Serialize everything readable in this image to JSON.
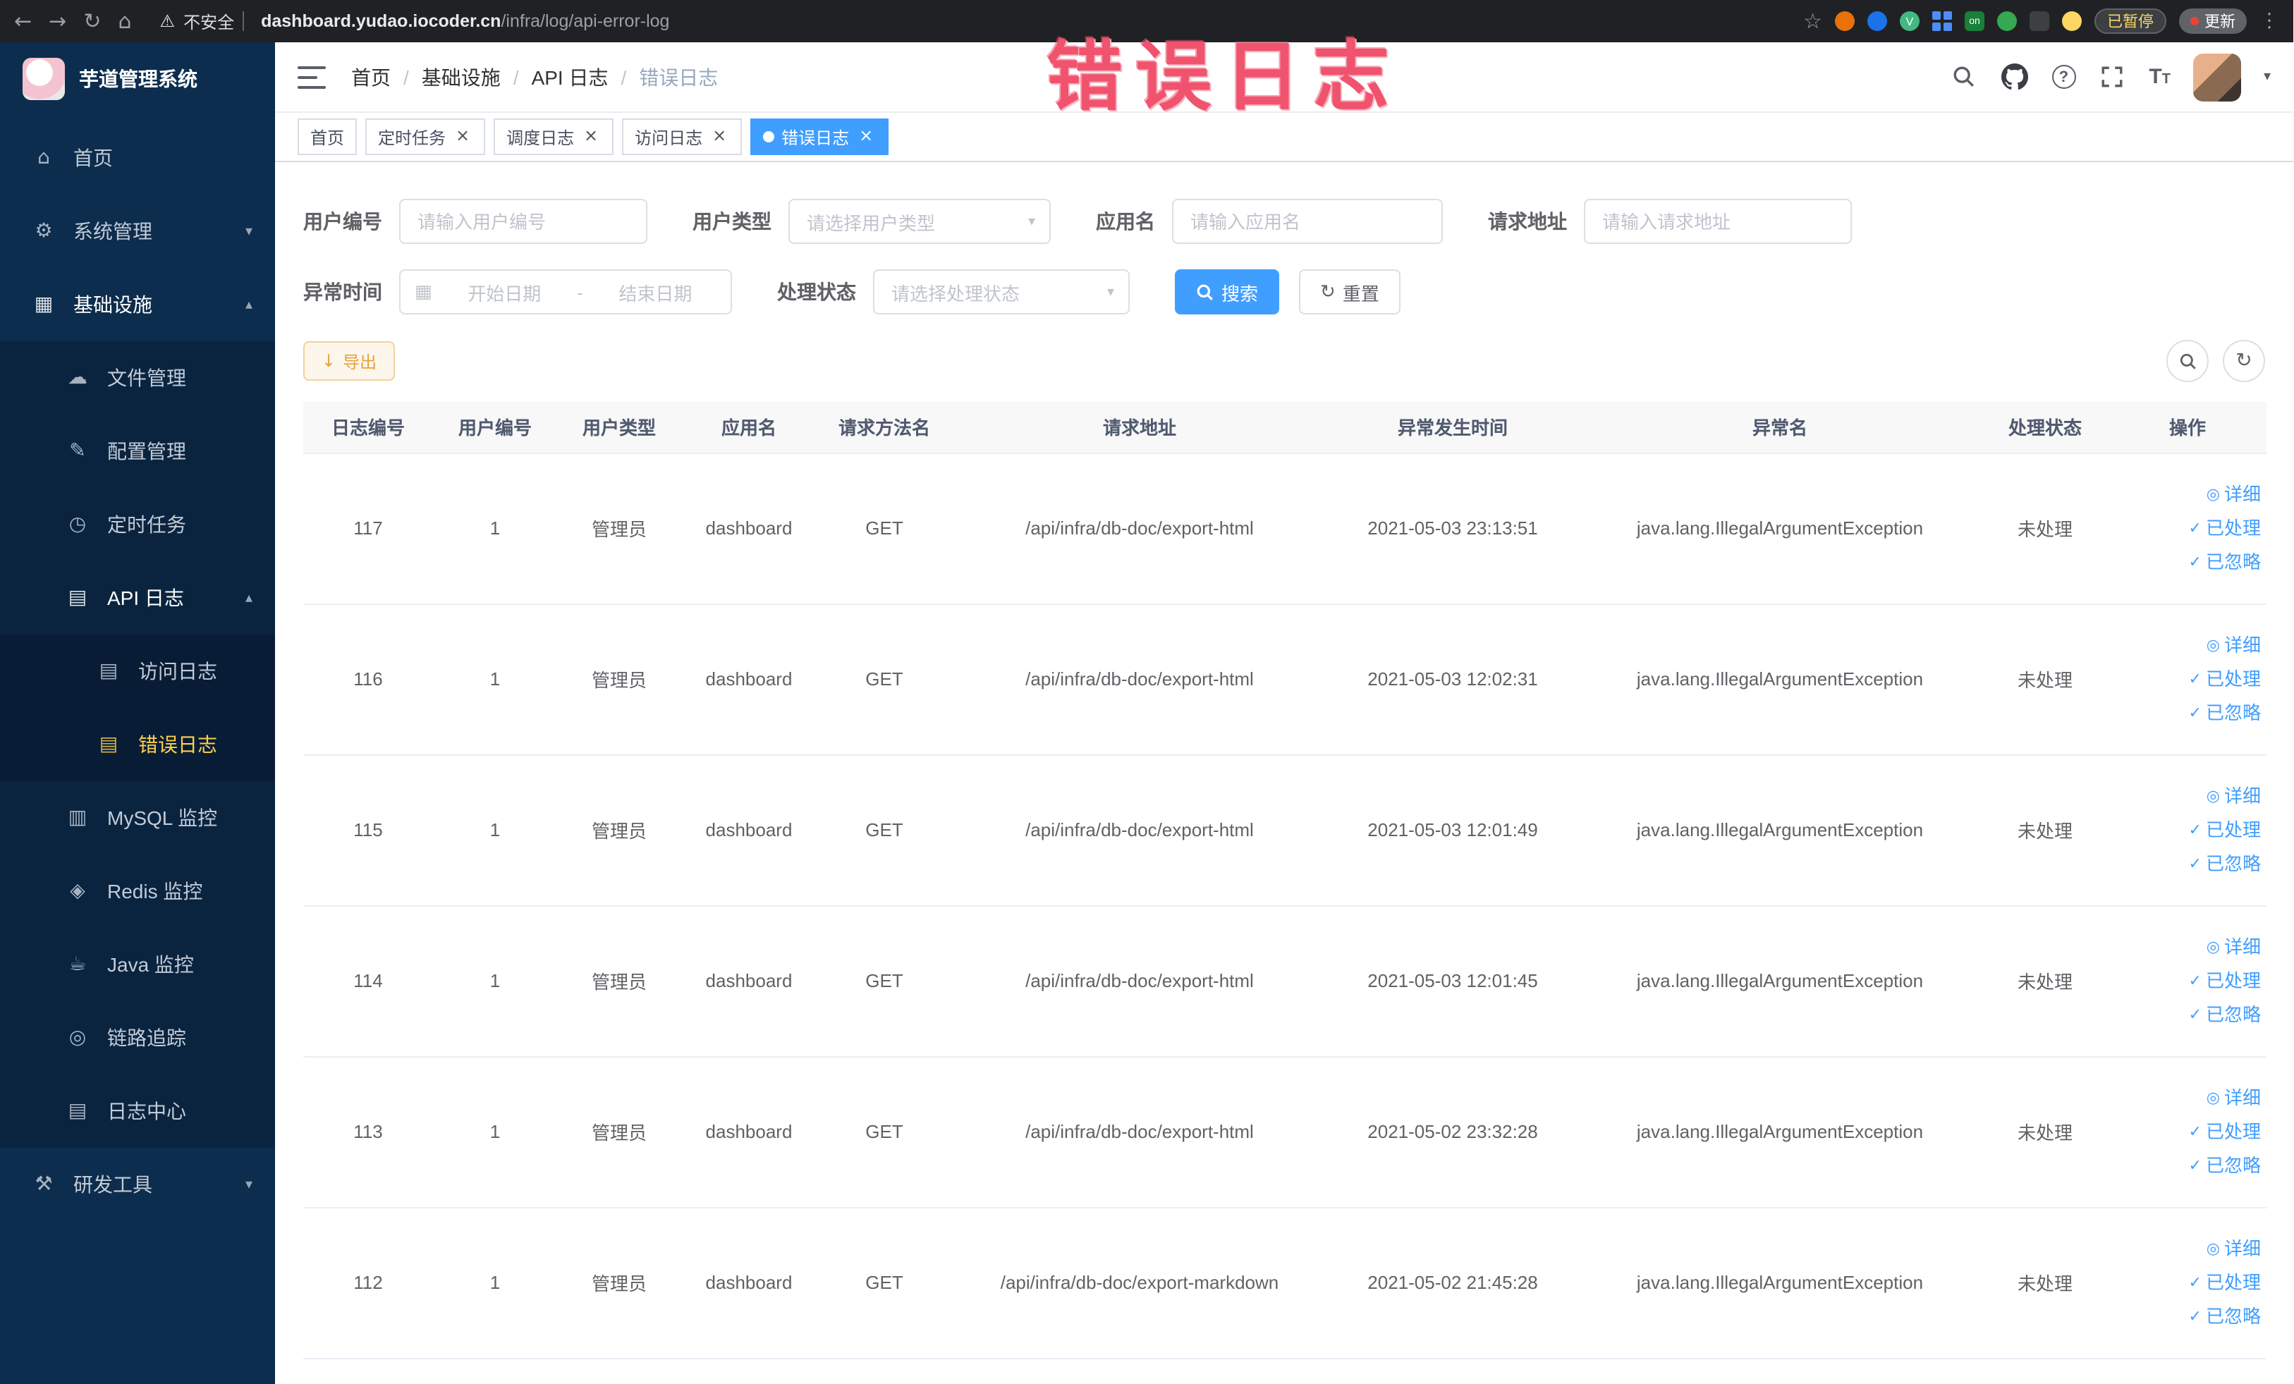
{
  "browser": {
    "security_label": "不安全",
    "url_domain": "dashboard.yudao.iocoder.cn",
    "url_path": "/infra/log/api-error-log",
    "extension_on_label": "on",
    "extension_v_label": "V",
    "paused_badge": "已暂停",
    "update_button": "更新"
  },
  "icons": {
    "back": "←",
    "forward": "→",
    "refresh": "↻",
    "home": "⌂",
    "star": "☆",
    "warning": "⚠",
    "dots": "⋮",
    "caret": "▾",
    "close": "×",
    "calendar": "▦",
    "eye": "◎",
    "check": "✓",
    "download": "↓",
    "chevron_down": "▾",
    "question": "?",
    "font_size_big": "T",
    "font_size_small": "T"
  },
  "annotation": {
    "text": "错误日志",
    "color": "#f0536e"
  },
  "sidebar": {
    "logo_title": "芋道管理系统",
    "items": [
      {
        "label": "首页",
        "icon": "⌂",
        "level": 1
      },
      {
        "label": "系统管理",
        "icon": "⚙",
        "level": 1,
        "arrow": "▾"
      },
      {
        "label": "基础设施",
        "icon": "▦",
        "level": 1,
        "arrow": "▴"
      },
      {
        "label": "文件管理",
        "icon": "☁",
        "level": 2
      },
      {
        "label": "配置管理",
        "icon": "✎",
        "level": 2
      },
      {
        "label": "定时任务",
        "icon": "◷",
        "level": 2
      },
      {
        "label": "API 日志",
        "icon": "▤",
        "level": 2,
        "arrow": "▴"
      },
      {
        "label": "访问日志",
        "icon": "▤",
        "level": 3
      },
      {
        "label": "错误日志",
        "icon": "▤",
        "level": 3,
        "active": true
      },
      {
        "label": "MySQL 监控",
        "icon": "▥",
        "level": 2
      },
      {
        "label": "Redis 监控",
        "icon": "◈",
        "level": 2
      },
      {
        "label": "Java 监控",
        "icon": "☕",
        "level": 2
      },
      {
        "label": "链路追踪",
        "icon": "◎",
        "level": 2
      },
      {
        "label": "日志中心",
        "icon": "▤",
        "level": 2
      },
      {
        "label": "研发工具",
        "icon": "⚒",
        "level": 1,
        "arrow": "▾"
      }
    ]
  },
  "navbar": {
    "breadcrumb": [
      "首页",
      "基础设施",
      "API 日志",
      "错误日志"
    ],
    "separator": "/"
  },
  "tabs": [
    {
      "label": "首页",
      "closable": false
    },
    {
      "label": "定时任务",
      "closable": true
    },
    {
      "label": "调度日志",
      "closable": true
    },
    {
      "label": "访问日志",
      "closable": true
    },
    {
      "label": "错误日志",
      "closable": true,
      "active": true
    }
  ],
  "filters": {
    "user_id": {
      "label": "用户编号",
      "placeholder": "请输入用户编号"
    },
    "user_type": {
      "label": "用户类型",
      "placeholder": "请选择用户类型"
    },
    "app_name": {
      "label": "应用名",
      "placeholder": "请输入应用名"
    },
    "request_url": {
      "label": "请求地址",
      "placeholder": "请输入请求地址"
    },
    "exception_time": {
      "label": "异常时间",
      "start_placeholder": "开始日期",
      "separator": "-",
      "end_placeholder": "结束日期"
    },
    "process_status": {
      "label": "处理状态",
      "placeholder": "请选择处理状态"
    },
    "search_button": "搜索",
    "reset_button": "重置"
  },
  "toolbar": {
    "export_button": "导出"
  },
  "table": {
    "headers": [
      "日志编号",
      "用户编号",
      "用户类型",
      "应用名",
      "请求方法名",
      "请求地址",
      "异常发生时间",
      "异常名",
      "处理状态",
      "操作"
    ],
    "actions": [
      "详细",
      "已处理",
      "已忽略"
    ],
    "rows": [
      {
        "log_id": "117",
        "user_id": "1",
        "user_type": "管理员",
        "app_name": "dashboard",
        "method": "GET",
        "url": "/api/infra/db-doc/export-html",
        "time": "2021-05-03 23:13:51",
        "exception": "java.lang.IllegalArgumentException",
        "status": "未处理"
      },
      {
        "log_id": "116",
        "user_id": "1",
        "user_type": "管理员",
        "app_name": "dashboard",
        "method": "GET",
        "url": "/api/infra/db-doc/export-html",
        "time": "2021-05-03 12:02:31",
        "exception": "java.lang.IllegalArgumentException",
        "status": "未处理"
      },
      {
        "log_id": "115",
        "user_id": "1",
        "user_type": "管理员",
        "app_name": "dashboard",
        "method": "GET",
        "url": "/api/infra/db-doc/export-html",
        "time": "2021-05-03 12:01:49",
        "exception": "java.lang.IllegalArgumentException",
        "status": "未处理"
      },
      {
        "log_id": "114",
        "user_id": "1",
        "user_type": "管理员",
        "app_name": "dashboard",
        "method": "GET",
        "url": "/api/infra/db-doc/export-html",
        "time": "2021-05-03 12:01:45",
        "exception": "java.lang.IllegalArgumentException",
        "status": "未处理"
      },
      {
        "log_id": "113",
        "user_id": "1",
        "user_type": "管理员",
        "app_name": "dashboard",
        "method": "GET",
        "url": "/api/infra/db-doc/export-html",
        "time": "2021-05-02 23:32:28",
        "exception": "java.lang.IllegalArgumentException",
        "status": "未处理"
      },
      {
        "log_id": "112",
        "user_id": "1",
        "user_type": "管理员",
        "app_name": "dashboard",
        "method": "GET",
        "url": "/api/infra/db-doc/export-markdown",
        "time": "2021-05-02 21:45:28",
        "exception": "java.lang.IllegalArgumentException",
        "status": "未处理"
      }
    ]
  },
  "colors": {
    "primary": "#409eff",
    "sidebar_bg": "#0c2d4d",
    "active_menu_text": "#ffd04b",
    "warning": "#e6a23c",
    "annotation": "#f0536e",
    "chrome_bg": "#202124"
  }
}
